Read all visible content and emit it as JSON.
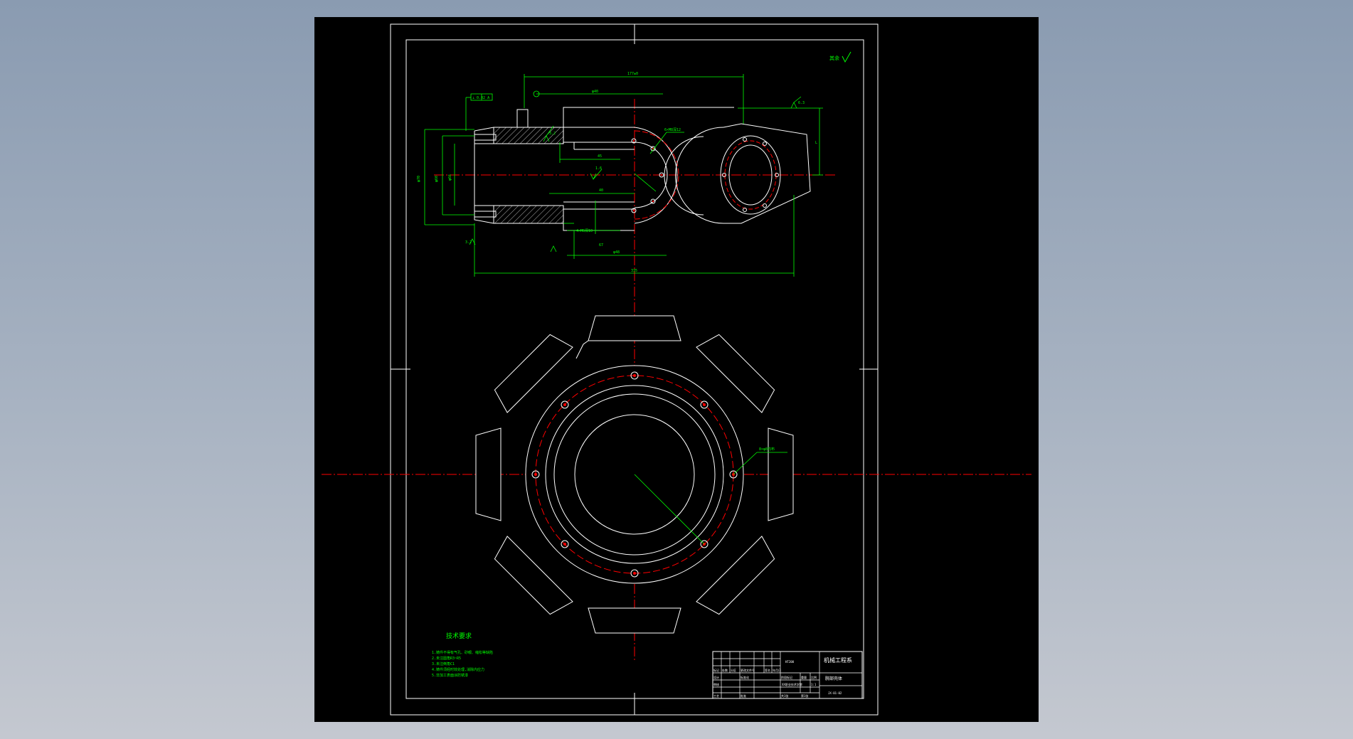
{
  "colors": {
    "background": "#000000",
    "outline": "#ffffff",
    "dimension": "#00ff00",
    "centerline": "#ff0000"
  },
  "top_view": {
    "overall_length": "335",
    "top_length": "177±0",
    "shaft_dia": "φ40",
    "hole_dia": "φ60",
    "dim_inner": "φ66",
    "dim_small_1": "45",
    "dim_small_2": "40",
    "dim_small_3": "67",
    "dim_small_4": "φ48",
    "dim_flange": "φ70",
    "right_height": "L",
    "hole_note_1": "6×M8深12",
    "hole_note_2": "4×M6深10",
    "tolerance_tag": "⊥ 0.02 A",
    "roughness_1": "3.2",
    "roughness_2": "1.6",
    "roughness_3": "3.2",
    "roughness_4": "6.3"
  },
  "bottom_view": {
    "hole_note": "8×φ8均布"
  },
  "corner_symbol": "其余",
  "technical_requirements": {
    "title": "技术要求",
    "items": [
      "1.铸件不得有气孔、砂眼、缩松等缺陷",
      "2.未注圆角R3~R5",
      "3.未注倒角C1",
      "4.铸件须经时效处理,消除内应力",
      "5.非加工表面涂防锈漆"
    ]
  },
  "title_block": {
    "school": "XX职业技术学院",
    "part_name": "机械工程系",
    "drawing_name": "腕部壳体",
    "material": "HT200",
    "scale": "1:1",
    "sheet": "第1张",
    "drawing_no": "JX-01-02",
    "cells": {
      "mark": "标记",
      "count": "处数",
      "zone": "分区",
      "change_no": "更改文件号",
      "sign": "签名",
      "date": "年月日",
      "designer": "设计",
      "checker": "审核",
      "process": "工艺",
      "approve": "批准",
      "standard": "标准化",
      "stage": "阶段标记",
      "weight": "重量",
      "ratio": "比例",
      "total": "共1张"
    }
  }
}
